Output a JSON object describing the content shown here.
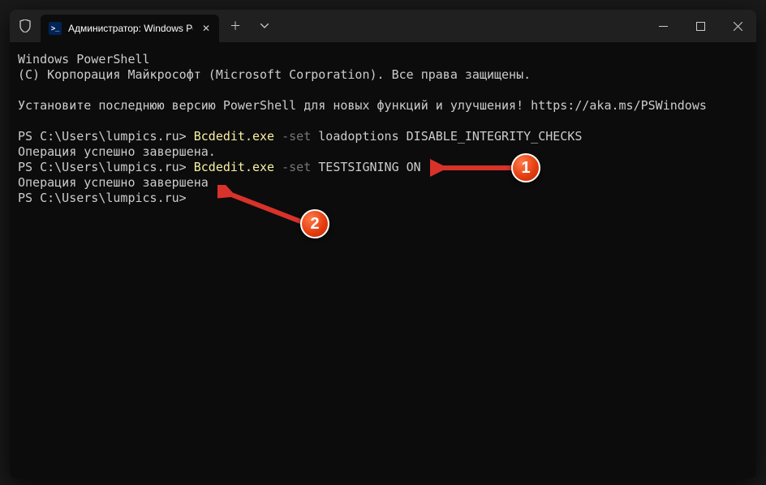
{
  "tab": {
    "title": "Администратор: Windows Po"
  },
  "terminal": {
    "line1": "Windows PowerShell",
    "line2": "(C) Корпорация Майкрософт (Microsoft Corporation). Все права защищены.",
    "line3": "",
    "line4": "Установите последнюю версию PowerShell для новых функций и улучшения! https://aka.ms/PSWindows",
    "line5": "",
    "prompt1": "PS C:\\Users\\lumpics.ru> ",
    "cmd1a": "Bcdedit.exe",
    "cmd1b": " -set",
    "cmd1c": " loadoptions DISABLE_INTEGRITY_CHECKS",
    "result1": "Операция успешно завершена.",
    "prompt2": "PS C:\\Users\\lumpics.ru> ",
    "cmd2a": "Bcdedit.exe",
    "cmd2b": " -set",
    "cmd2c": " TESTSIGNING ON",
    "result2": "Операция успешно завершена",
    "prompt3": "PS C:\\Users\\lumpics.ru>"
  },
  "badges": {
    "b1": "1",
    "b2": "2"
  }
}
